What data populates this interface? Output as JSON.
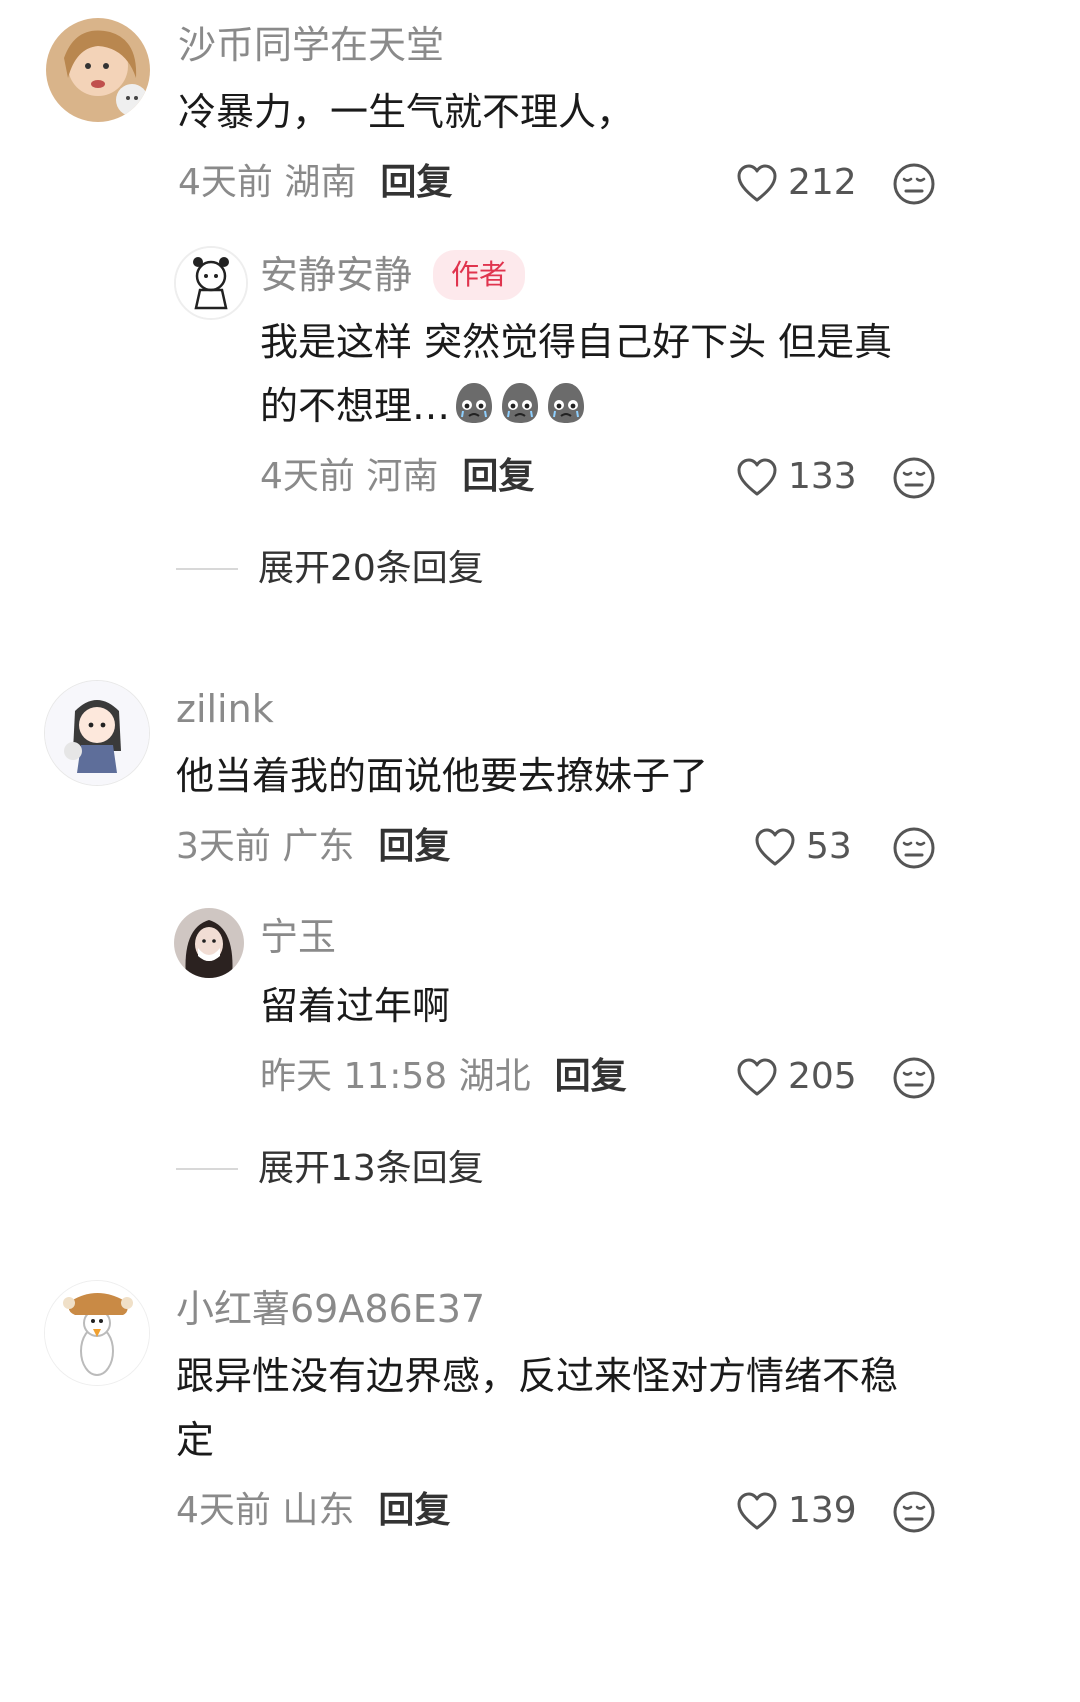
{
  "comments": [
    {
      "user": "沙币同学在天堂",
      "text": "冷暴力，一生气就不理人，",
      "time_location": "4天前 湖南",
      "reply_label": "回复",
      "likes": "212",
      "reply": {
        "user": "安静安静",
        "badge": "作者",
        "text_line1": "我是这样 突然觉得自己好下头 但是真",
        "text_line2": "的不想理…",
        "time_location": "4天前 河南",
        "reply_label": "回复",
        "likes": "133"
      },
      "expand": "展开20条回复"
    },
    {
      "user": "zilink",
      "text": "他当着我的面说他要去撩妹子了",
      "time_location": "3天前 广东",
      "reply_label": "回复",
      "likes": "53",
      "reply": {
        "user": "宁玉",
        "text_line1": "留着过年啊",
        "time_location": "昨天 11:58 湖北",
        "reply_label": "回复",
        "likes": "205"
      },
      "expand": "展开13条回复"
    },
    {
      "user": "小红薯69A86E37",
      "text_line1": "跟异性没有边界感，反过来怪对方情绪不稳",
      "text_line2": "定",
      "time_location": "4天前 山东",
      "reply_label": "回复",
      "likes": "139"
    }
  ],
  "icons": {
    "like": "heart-outline-icon",
    "dislike": "unamused-face-icon",
    "emoji": "crying-potato-emoji"
  },
  "colors": {
    "author_badge_text": "#e0344e",
    "author_badge_bg": "#fde9ec",
    "secondary_text": "#8a8a8a"
  }
}
